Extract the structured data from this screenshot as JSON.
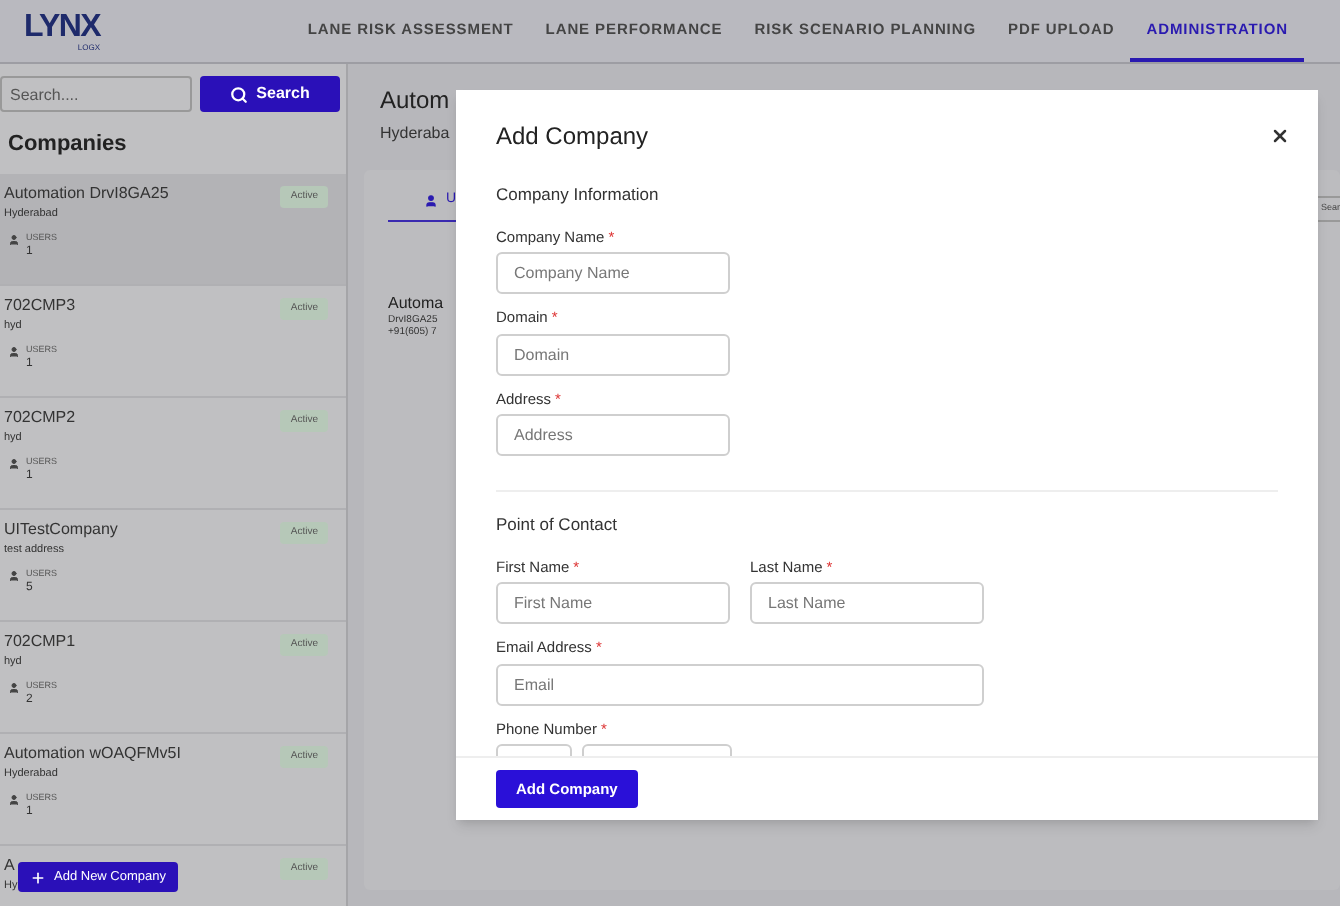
{
  "header": {
    "logo": {
      "text": "LYNX",
      "subtext": "LOGX"
    },
    "nav": [
      {
        "label": "LANE RISK ASSESSMENT",
        "selected": false
      },
      {
        "label": "LANE PERFORMANCE",
        "selected": false
      },
      {
        "label": "RISK SCENARIO PLANNING",
        "selected": false
      },
      {
        "label": "PDF UPLOAD",
        "selected": false
      },
      {
        "label": "ADMINISTRATION",
        "selected": true
      }
    ]
  },
  "sidebar": {
    "search": {
      "placeholder": "Search...."
    },
    "search_button": "Search",
    "title": "Companies",
    "companies": [
      {
        "name": "Automation DrvI8GA25",
        "address": "Hyderabad",
        "users_label": "USERS",
        "users": "1",
        "status": "Active",
        "selected": true
      },
      {
        "name": "702CMP3",
        "address": "hyd",
        "users_label": "USERS",
        "users": "1",
        "status": "Active",
        "selected": false
      },
      {
        "name": "702CMP2",
        "address": "hyd",
        "users_label": "USERS",
        "users": "1",
        "status": "Active",
        "selected": false
      },
      {
        "name": "UITestCompany",
        "address": "test address",
        "users_label": "USERS",
        "users": "5",
        "status": "Active",
        "selected": false
      },
      {
        "name": "702CMP1",
        "address": "hyd",
        "users_label": "USERS",
        "users": "2",
        "status": "Active",
        "selected": false
      },
      {
        "name": "Automation wOAQFMv5I",
        "address": "Hyderabad",
        "users_label": "USERS",
        "users": "1",
        "status": "Active",
        "selected": false
      },
      {
        "name": "A",
        "address": "Hy",
        "status": "Active",
        "selected": false
      }
    ],
    "add_button": "Add New Company"
  },
  "main": {
    "title": "Autom",
    "subtitle": "Hyderaba",
    "tab": {
      "label": "U",
      "selected": true
    },
    "detail": {
      "name": "Automa",
      "code": "DrvI8GA25",
      "phone": "+91(605) 7"
    },
    "search_fragment": "Sear"
  },
  "modal": {
    "title": "Add Company",
    "company_info": {
      "heading": "Company Information",
      "fields": [
        {
          "label": "Company Name",
          "required_mark": "*",
          "placeholder": "Company Name"
        },
        {
          "label": "Domain",
          "required_mark": "*",
          "placeholder": "Domain"
        },
        {
          "label": "Address",
          "required_mark": "*",
          "placeholder": "Address"
        }
      ]
    },
    "contact": {
      "heading": "Point of Contact",
      "first_name": {
        "label": "First Name",
        "required_mark": "*",
        "placeholder": "First Name"
      },
      "last_name": {
        "label": "Last Name",
        "required_mark": "*",
        "placeholder": "Last Name"
      },
      "email": {
        "label": "Email Address",
        "required_mark": "*",
        "placeholder": "Email"
      },
      "phone": {
        "label": "Phone Number",
        "required_mark": "*"
      }
    },
    "submit": "Add Company"
  }
}
